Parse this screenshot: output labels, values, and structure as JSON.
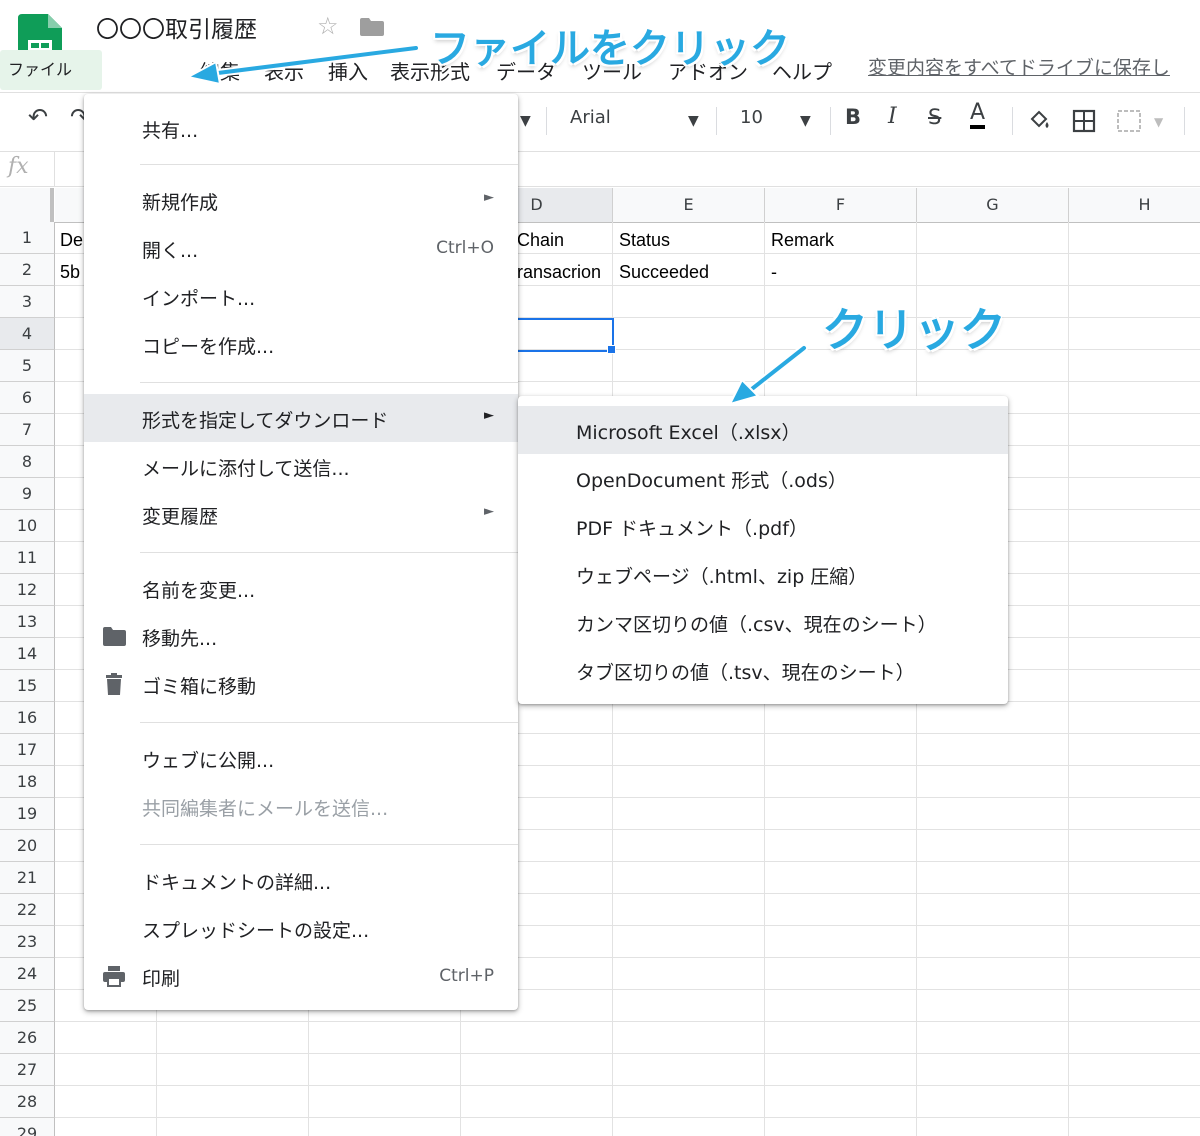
{
  "app": {
    "title": "〇〇〇取引履歴"
  },
  "menubar": {
    "items": [
      "ファイル",
      "編集",
      "表示",
      "挿入",
      "表示形式",
      "データ",
      "ツール",
      "アドオン",
      "ヘルプ"
    ],
    "save_status": "変更内容をすべてドライブに保存し"
  },
  "toolbar": {
    "font": "Arial",
    "font_size": "10"
  },
  "formula": {
    "fx": "fx"
  },
  "grid": {
    "columns": [
      "",
      "",
      "",
      "D",
      "E",
      "F",
      "G",
      "H"
    ],
    "rows": [
      "1",
      "2",
      "3",
      "4",
      "5",
      "6",
      "7",
      "8",
      "9",
      "10",
      "11",
      "12",
      "13",
      "14",
      "15",
      "16",
      "17",
      "18",
      "19",
      "20",
      "21",
      "22",
      "23",
      "24",
      "25",
      "26",
      "27",
      "28",
      "29"
    ],
    "cells": {
      "a1": "De",
      "a2": "5b",
      "d1": "Chain",
      "d2": "ransacrion",
      "e1": "Status",
      "e2": "Succeeded",
      "f1": "Remark",
      "f2": "-"
    }
  },
  "file_menu": {
    "share": "共有...",
    "new": "新規作成",
    "open": "開く...",
    "open_shortcut": "Ctrl+O",
    "import": "インポート...",
    "copy": "コピーを作成...",
    "download": "形式を指定してダウンロード",
    "email_attach": "メールに添付して送信...",
    "history": "変更履歴",
    "rename": "名前を変更...",
    "move": "移動先...",
    "trash": "ゴミ箱に移動",
    "publish": "ウェブに公開...",
    "email_collab": "共同編集者にメールを送信...",
    "details": "ドキュメントの詳細...",
    "settings": "スプレッドシートの設定...",
    "print": "印刷",
    "print_shortcut": "Ctrl+P",
    "submenu_arrow": "►"
  },
  "download_menu": {
    "items": [
      "Microsoft Excel（.xlsx）",
      "OpenDocument 形式（.ods）",
      "PDF ドキュメント（.pdf）",
      "ウェブページ（.html、zip 圧縮）",
      "カンマ区切りの値（.csv、現在のシート）",
      "タブ区切りの値（.tsv、現在のシート）"
    ]
  },
  "annotations": {
    "file_click": "ファイルをクリック",
    "click": "クリック"
  },
  "colors": {
    "accent": "#29a9e1",
    "brand": "#0f9d58",
    "selection": "#1a73e8"
  }
}
